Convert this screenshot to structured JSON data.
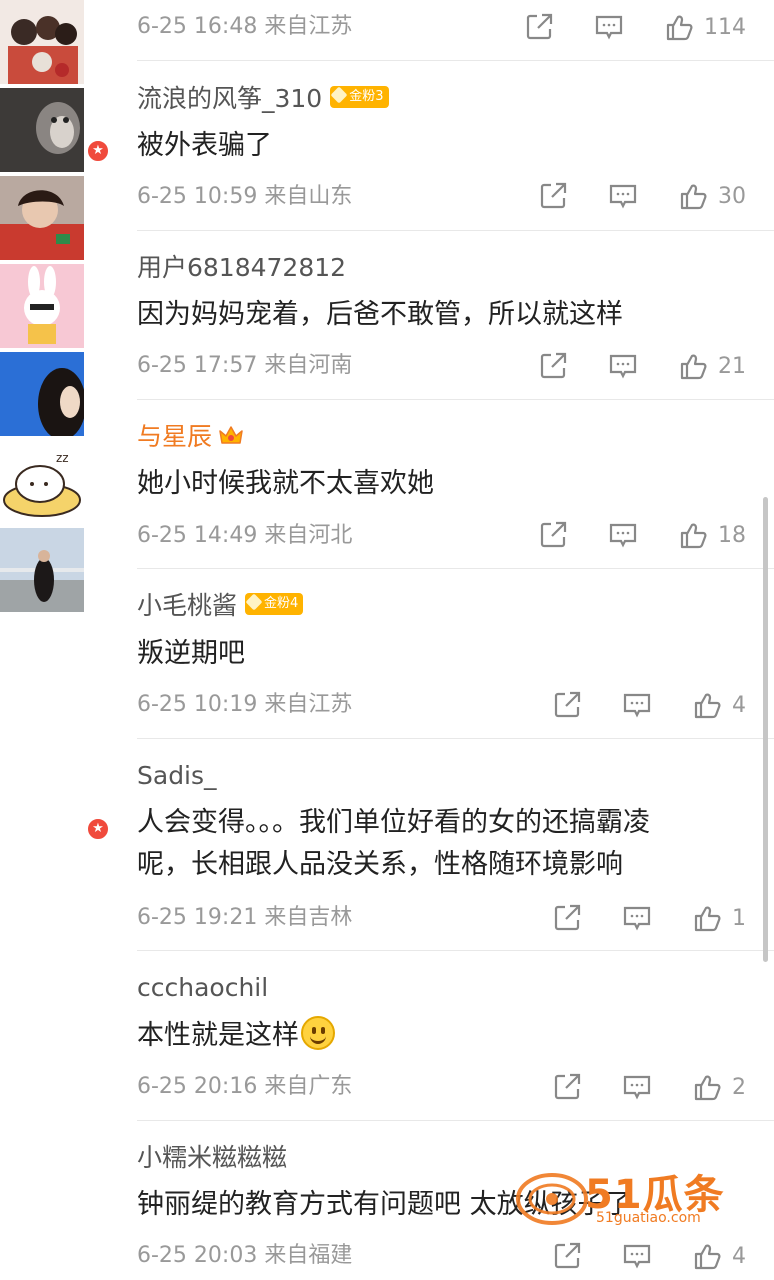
{
  "first_row": {
    "meta": "6-25 16:48  来自江苏",
    "likes": "114"
  },
  "comments": [
    {
      "username": "流浪的风筝_310",
      "badge": "金粉3",
      "text": [
        "被外表骗了"
      ],
      "meta": "6-25 10:59  来自山东",
      "likes": "30"
    },
    {
      "username": "用户6818472812",
      "text": [
        "因为妈妈宠着，后爸不敢管，所以就这样"
      ],
      "meta": "6-25 17:57  来自河南",
      "likes": "21"
    },
    {
      "username": "与星辰",
      "text": [
        "她小时候我就不太喜欢她"
      ],
      "meta": "6-25 14:49  来自河北",
      "likes": "18"
    },
    {
      "username": "小毛桃酱",
      "badge": "金粉4",
      "text": [
        "叛逆期吧"
      ],
      "meta": "6-25 10:19  来自江苏",
      "likes": "4"
    },
    {
      "username": "Sadis_",
      "text": [
        "人会变得。。。我们单位好看的女的还搞霸凌",
        "呢，长相跟人品没关系，性格随环境影响"
      ],
      "meta": "6-25 19:21  来自吉林",
      "likes": "1"
    },
    {
      "username": "ccchaochil",
      "text": [
        "本性就是这样"
      ],
      "meta": "6-25 20:16  来自广东",
      "likes": "2"
    },
    {
      "username": "小糯米糍糍糍",
      "text": [
        "钟丽缇的教育方式有问题吧 太放纵孩子了"
      ],
      "meta": "6-25 20:03  来自福建",
      "likes": "4"
    }
  ],
  "watermark": {
    "brand": "51瓜条",
    "domain": "51guatiao.com"
  }
}
